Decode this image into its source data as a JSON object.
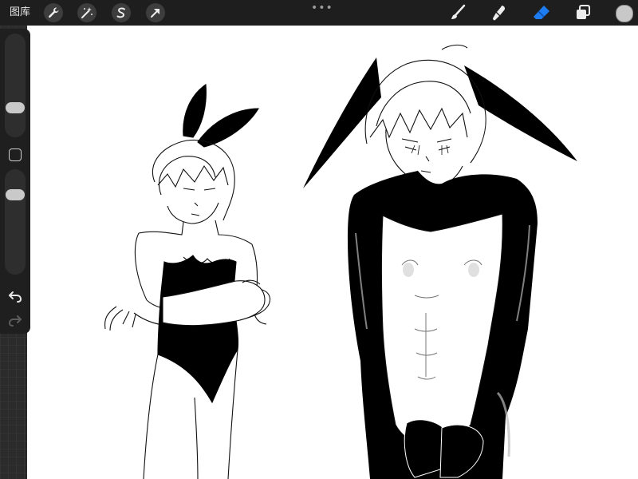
{
  "topbar": {
    "gallery_label": "图库",
    "left_tools": [
      "wrench-icon",
      "magic-wand-icon",
      "selection-s-icon",
      "transform-arrow-icon"
    ],
    "right_tools": [
      "brush-icon",
      "smudge-icon",
      "eraser-icon",
      "layers-icon"
    ],
    "active_tool": "eraser-icon",
    "active_tool_color": "#1e7cf2",
    "icon_color": "#ededed",
    "current_color": "#c8c8c8"
  },
  "sidebar": {
    "brush_size": 0.25,
    "brush_opacity": 0.2,
    "undo_icon": "undo-arrow-icon",
    "redo_icon": "redo-arrow-icon"
  }
}
